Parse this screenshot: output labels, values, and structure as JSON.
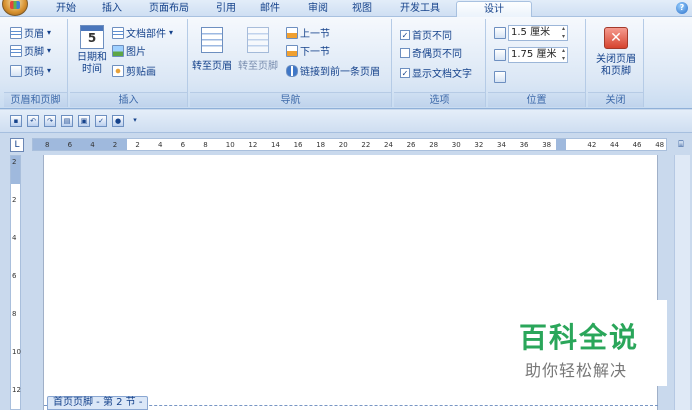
{
  "tabs": [
    {
      "label": "开始"
    },
    {
      "label": "插入"
    },
    {
      "label": "页面布局"
    },
    {
      "label": "引用"
    },
    {
      "label": "邮件"
    },
    {
      "label": "审阅"
    },
    {
      "label": "视图"
    },
    {
      "label": "开发工具"
    },
    {
      "label": "设计",
      "active": true
    }
  ],
  "ribbon": {
    "header_footer": {
      "label": "页眉和页脚",
      "items": [
        {
          "label": "页眉"
        },
        {
          "label": "页脚"
        },
        {
          "label": "页码"
        }
      ]
    },
    "insert": {
      "label": "插入",
      "date_time": "日期和时间",
      "calendar_number": "5",
      "doc_parts": "文档部件",
      "picture": "图片",
      "clipart": "剪贴画"
    },
    "navigation": {
      "label": "导航",
      "goto_header": "转至页眉",
      "goto_footer": "转至页脚",
      "prev_section": "上一节",
      "next_section": "下一节",
      "link_previous": "链接到前一条页眉"
    },
    "options": {
      "label": "选项",
      "items": [
        {
          "label": "首页不同",
          "checked": true
        },
        {
          "label": "奇偶页不同",
          "checked": false
        },
        {
          "label": "显示文档文字",
          "checked": true
        }
      ]
    },
    "position": {
      "label": "位置",
      "header_distance": "1.5 厘米",
      "footer_distance": "1.75 厘米"
    },
    "close": {
      "label": "关闭",
      "button": "关闭页眉和页脚"
    }
  },
  "ruler": {
    "ticks": [
      "8",
      "6",
      "4",
      "2",
      "2",
      "4",
      "6",
      "8",
      "10",
      "12",
      "14",
      "16",
      "18",
      "20",
      "22",
      "24",
      "26",
      "28",
      "30",
      "32",
      "34",
      "36",
      "38",
      "42",
      "44",
      "46",
      "48"
    ],
    "corner": "L"
  },
  "vruler": {
    "ticks": [
      "2",
      "2",
      "4",
      "6",
      "8",
      "10",
      "12"
    ]
  },
  "footer_tag": "首页页脚 - 第 2 节 -",
  "watermark": {
    "title": "百科全说",
    "subtitle": "助你轻松解决"
  },
  "colors": {
    "ribbon_text": "#15428b",
    "accent_green": "#2aa65a"
  }
}
